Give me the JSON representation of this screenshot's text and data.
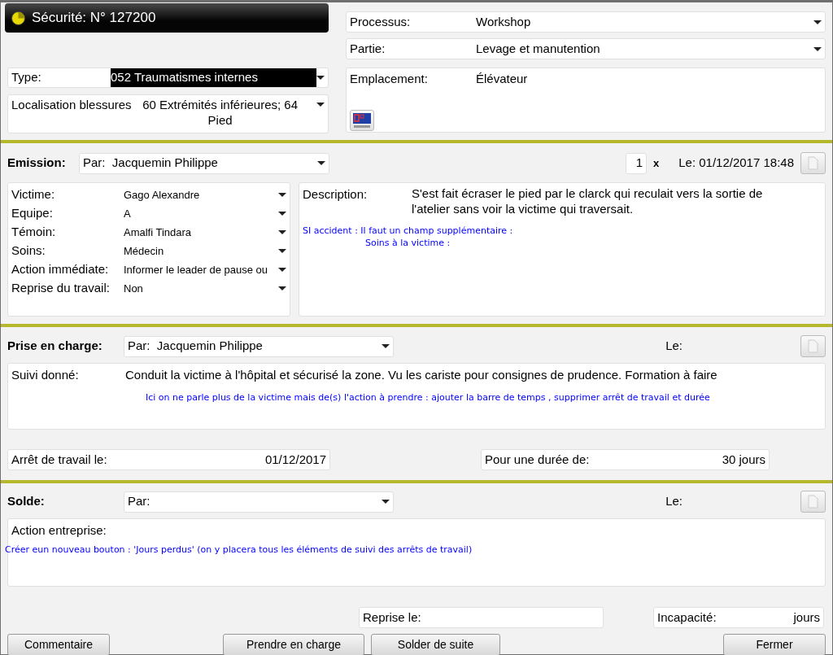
{
  "header": {
    "title": "Sécurité: N° 127200"
  },
  "classification": [
    {
      "label": "Type:",
      "value": "052 Traumatismes internes",
      "highlighted": true
    },
    {
      "label": "Localisation blessures",
      "value": "60 Extrémités inférieures; 64 Pied",
      "highlighted": false
    }
  ],
  "context": [
    {
      "label": "Processus:",
      "value": "Workshop"
    },
    {
      "label": "Partie:",
      "value": "Levage et manutention"
    }
  ],
  "location": {
    "label": "Emplacement:",
    "value": "Élévateur"
  },
  "emission": {
    "heading": "Emission:",
    "by": "Par:  Jacquemin Philippe",
    "count": "1",
    "count_suffix": "x",
    "date": "Le: 01/12/2017 18:48",
    "details": [
      {
        "label": "Victime:",
        "value": "Gago Alexandre"
      },
      {
        "label": "Equipe:",
        "value": "A"
      },
      {
        "label": "Témoin:",
        "value": "Amalfi Tindara"
      },
      {
        "label": "Soins:",
        "value": "Médecin"
      },
      {
        "label": "Action immédiate:",
        "value": "Informer le leader de pause ou"
      },
      {
        "label": "Reprise du travail:",
        "value": "Non"
      }
    ],
    "description": {
      "label": "Description:",
      "text": "S'est fait écraser le pied par le clarck qui reculait vers la sortie de l'atelier sans voir la victime qui traversait.",
      "notes": [
        "SI accident : Il faut un champ supplémentaire :",
        "Soins à la victime :"
      ]
    }
  },
  "handling": {
    "heading": "Prise en charge:",
    "by": "Par:  Jacquemin Philippe",
    "date": "Le:",
    "follow_label": "Suivi donné:",
    "follow_text": "Conduit la victime à l'hôpital et sécurisé la zone. Vu les cariste pour consignes de prudence.  Formation à faire",
    "note": "Ici on ne parle plus de la victime mais de(s) l'action à prendre : ajouter la barre de temps , supprimer arrêt de travail et durée",
    "stop": {
      "label": "Arrêt de travail le:",
      "value": "01/12/2017"
    },
    "duration": {
      "label": "Pour une durée de:",
      "value": "30 jours"
    }
  },
  "closing": {
    "heading": "Solde:",
    "by": "Par:",
    "date": "Le:",
    "action_label": "Action entreprise:",
    "note": "Créer eun nouveau bouton : 'Jours perdus' (on y placera tous les éléments de suivi des arrêts de travail)",
    "resume": {
      "label": "Reprise le:"
    },
    "incapacity": {
      "label": "Incapacité:",
      "unit": "jours"
    }
  },
  "buttons": [
    "Commentaire",
    "Prendre en charge",
    "Solder de suite",
    "Fermer"
  ]
}
